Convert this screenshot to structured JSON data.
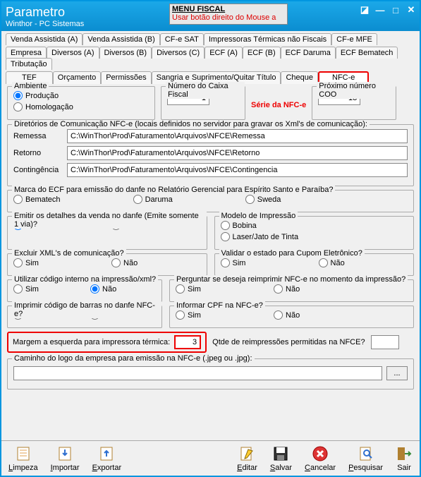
{
  "title": "Parametro",
  "subtitle": "Winthor - PC Sistemas",
  "menu_fiscal": {
    "title": "MENU FISCAL",
    "body": "Usar botão direito do Mouse a"
  },
  "tabs_row1": [
    "Venda Assistida (A)",
    "Venda Assistida (B)",
    "CF-e SAT",
    "Impressoras Térmicas não Fiscais",
    "CF-e MFE"
  ],
  "tabs_row2": [
    "Empresa",
    "Diversos (A)",
    "Diversos (B)",
    "Diversos (C)",
    "ECF (A)",
    "ECF (B)",
    "ECF Daruma",
    "ECF Bematech",
    "Tributação"
  ],
  "tabs_row3": [
    "TEF",
    "Orçamento",
    "Permissões",
    "Sangria e Suprimento/Quitar Título",
    "Cheque",
    "NFC-e"
  ],
  "ambiente": {
    "label": "Ambiente",
    "producao": "Produção",
    "homolog": "Homologação"
  },
  "caixa": {
    "label": "Número do Caixa Fiscal",
    "value": "1"
  },
  "serie_label": "Série da NFC-e",
  "coo": {
    "label": "Próximo número COO",
    "value": "13"
  },
  "diretorios": {
    "label": "Diretórios de Comunicação NFC-e (locais definidos no servidor para gravar os Xml's de comunicação):",
    "remessa_lbl": "Remessa",
    "remessa": "C:\\WinThor\\Prod\\Faturamento\\Arquivos\\NFCE\\Remessa",
    "retorno_lbl": "Retorno",
    "retorno": "C:\\WinThor\\Prod\\Faturamento\\Arquivos\\NFCE\\Retorno",
    "conting_lbl": "Contingência",
    "conting": "C:\\WinThor\\Prod\\Faturamento\\Arquivos\\NFCE\\Contingencia"
  },
  "marca_ecf": {
    "label": "Marca do ECF para emissão do danfe no Relatório Gerencial para Espírito Santo e Paraíba?",
    "bematech": "Bematech",
    "daruma": "Daruma",
    "sweda": "Sweda"
  },
  "sim": "Sim",
  "nao": "Não",
  "emitir_detalhes": "Emitir os detalhes da venda no danfe (Emite somente 1 via)?",
  "modelo_imp": {
    "label": "Modelo de Impressão",
    "bobina": "Bobina",
    "laser": "Laser/Jato de Tinta"
  },
  "excluir_xml": "Excluir XML's de comunicação?",
  "validar_estado": "Validar o estado para Cupom Eletrônico?",
  "utilizar_codigo": "Utilizar código interno na impressão/xml?",
  "perguntar_reimp": "Perguntar se deseja reimprimir NFC-e no momento da impressão?",
  "imprimir_barras": "Imprimir código de barras no danfe NFC-e?",
  "informar_cpf": "Informar CPF na NFC-e?",
  "margem_label": "Margem a esquerda para impressora térmica:",
  "margem_value": "3",
  "qtde_reimp": "Qtde de reimpressões permitidas na NFCE?",
  "caminho_logo": "Caminho do logo da empresa para emissão na NFC-e (.jpeg ou .jpg):",
  "browse": "...",
  "toolbar": {
    "limpeza": "Limpeza",
    "importar": "Importar",
    "exportar": "Exportar",
    "editar": "Editar",
    "salvar": "Salvar",
    "cancelar": "Cancelar",
    "pesquisar": "Pesquisar",
    "sair": "Sair"
  }
}
